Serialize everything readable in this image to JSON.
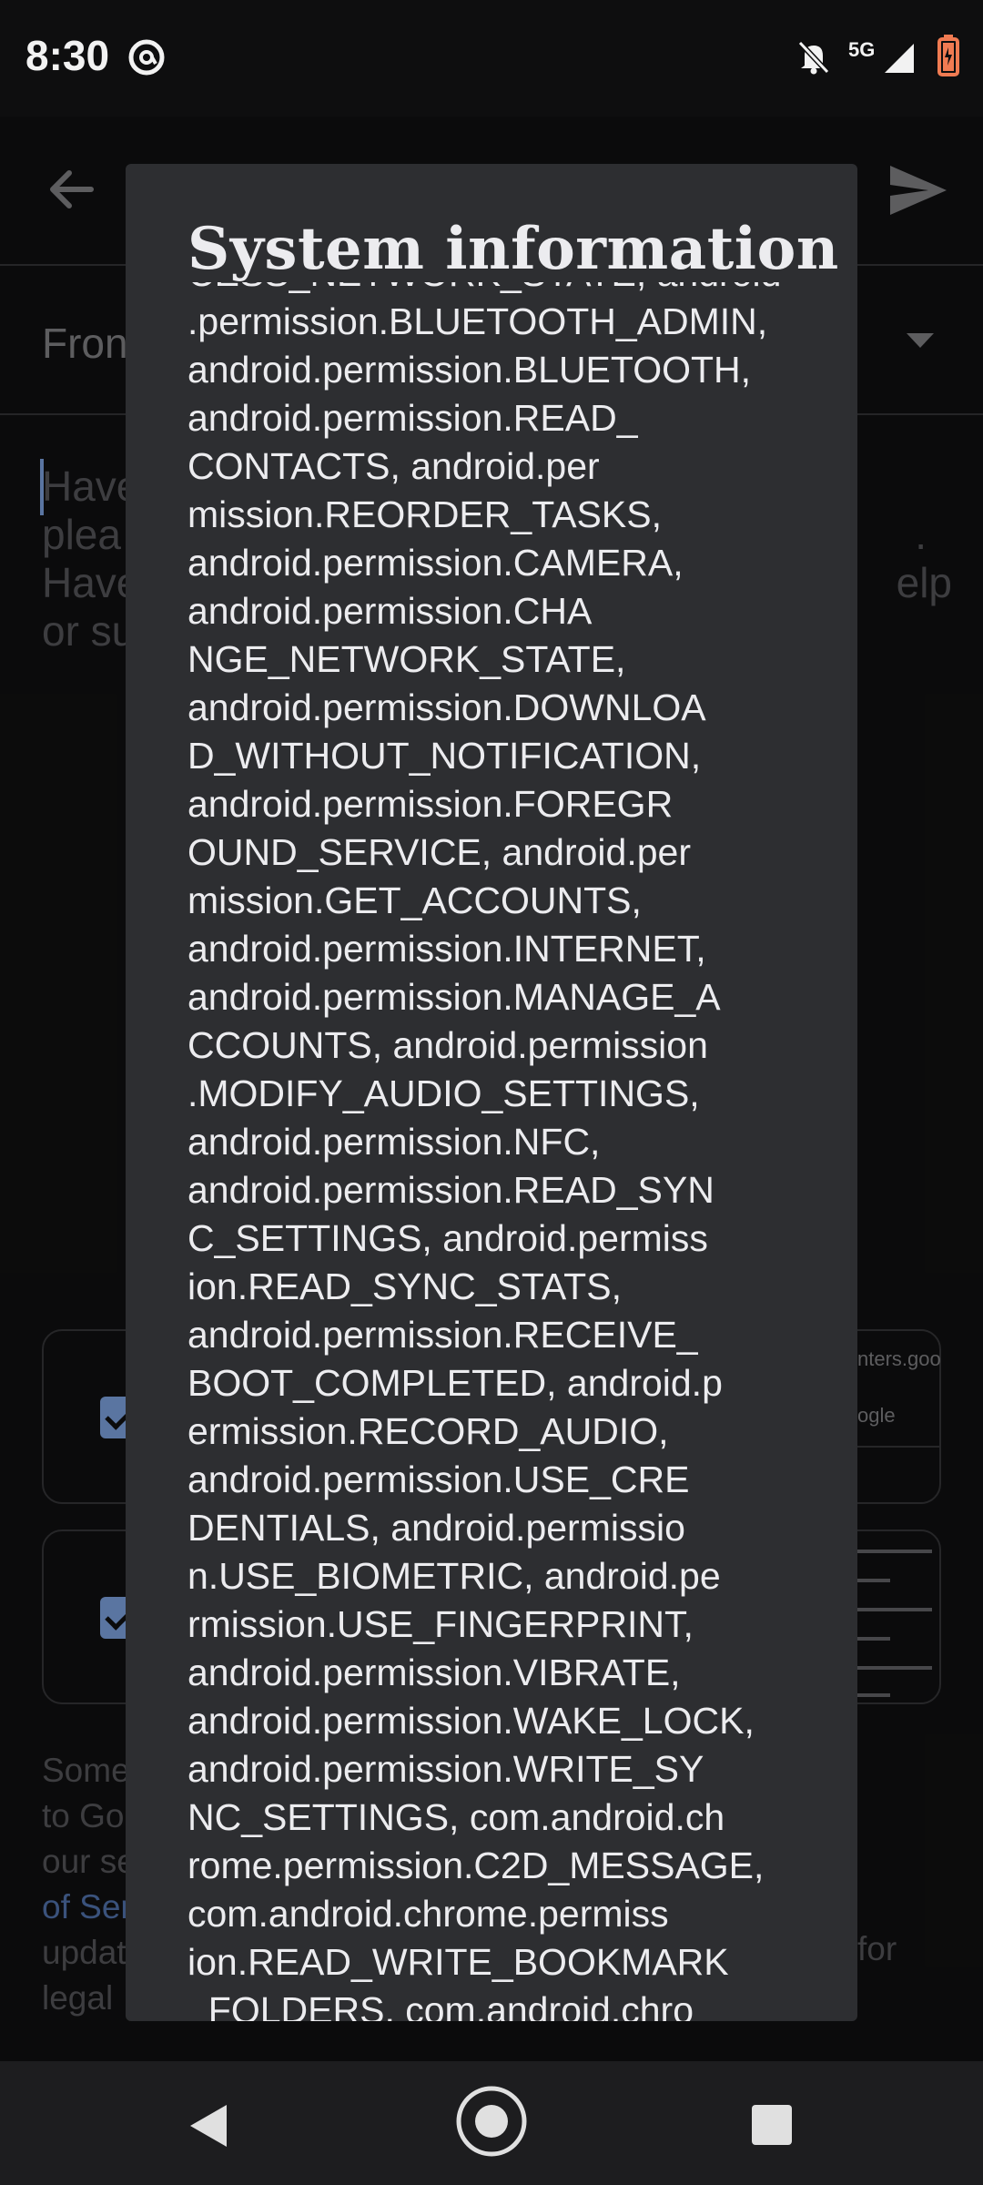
{
  "status_bar": {
    "time": "8:30",
    "network": "5G",
    "icons": [
      "at-sign-icon",
      "notifications-off-icon",
      "signal-icon",
      "battery-charging-icon"
    ],
    "battery_color": "#f07b52"
  },
  "background": {
    "from_label": "Fron",
    "hint_lines": [
      "Have",
      "plea",
      "Have",
      "or su"
    ],
    "hint_right": [
      "",
      ".",
      "elp",
      ""
    ],
    "card1_thumb": [
      "nters.goo",
      "ogle"
    ],
    "footer_lines": [
      "Some",
      "to Go",
      "our se",
      "of Ser",
      "updat",
      "legal"
    ],
    "footer_right": "for",
    "link_color": "#5a7fbf"
  },
  "dialog": {
    "title": "System information",
    "content": "CESS_NETWORK_STATE, android\n.permission.BLUETOOTH_ADMIN,\nandroid.permission.BLUETOOTH,\nandroid.permission.READ_\nCONTACTS, android.per\nmission.REORDER_TASKS,\nandroid.permission.CAMERA,\nandroid.permission.CHA\nNGE_NETWORK_STATE,\nandroid.permission.DOWNLOA\nD_WITHOUT_NOTIFICATION,\nandroid.permission.FOREGR\nOUND_SERVICE, android.per\nmission.GET_ACCOUNTS,\nandroid.permission.INTERNET,\nandroid.permission.MANAGE_A\nCCOUNTS, android.permission\n.MODIFY_AUDIO_SETTINGS,\nandroid.permission.NFC,\nandroid.permission.READ_SYN\nC_SETTINGS, android.permiss\nion.READ_SYNC_STATS,\nandroid.permission.RECEIVE_\nBOOT_COMPLETED, android.p\nermission.RECORD_AUDIO,\nandroid.permission.USE_CRE\nDENTIALS, android.permissio\nn.USE_BIOMETRIC, android.pe\nrmission.USE_FINGERPRINT,\nandroid.permission.VIBRATE,\nandroid.permission.WAKE_LOCK,\nandroid.permission.WRITE_SY\nNC_SETTINGS, com.android.ch\nrome.permission.C2D_MESSAGE,\ncom.android.chrome.permiss\nion.READ_WRITE_BOOKMARK\n_FOLDERS, com.android.chro"
  },
  "nav": {
    "icons": [
      "nav-back-icon",
      "nav-home-icon",
      "nav-recents-icon"
    ]
  }
}
